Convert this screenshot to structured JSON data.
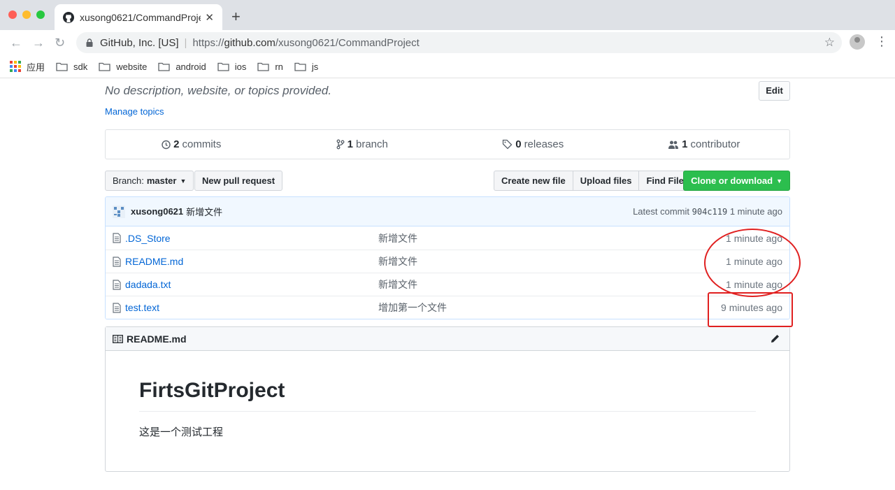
{
  "browser": {
    "tab_title": "xusong0621/CommandProject",
    "tab_close": "✕",
    "new_tab": "+",
    "site_identity": "GitHub, Inc. [US]",
    "url_prefix": "https://",
    "url_host": "github.com",
    "url_path": "/xusong0621/CommandProject",
    "bookmarks": [
      {
        "label": "应用"
      },
      {
        "label": "sdk"
      },
      {
        "label": "website"
      },
      {
        "label": "android"
      },
      {
        "label": "ios"
      },
      {
        "label": "rn"
      },
      {
        "label": "js"
      }
    ]
  },
  "repo": {
    "description": "No description, website, or topics provided.",
    "manage_topics": "Manage topics",
    "edit_label": "Edit",
    "numbers": [
      {
        "icon": "history-icon",
        "count": "2",
        "label": "commits"
      },
      {
        "icon": "branch-icon",
        "count": "1",
        "label": "branch"
      },
      {
        "icon": "tag-icon",
        "count": "0",
        "label": "releases"
      },
      {
        "icon": "people-icon",
        "count": "1",
        "label": "contributor"
      }
    ]
  },
  "file_nav": {
    "branch_prefix": "Branch:",
    "branch_name": "master",
    "new_pull_request": "New pull request",
    "create_new_file": "Create new file",
    "upload_files": "Upload files",
    "find_file": "Find File",
    "clone": "Clone or download"
  },
  "commit": {
    "author": "xusong0621",
    "message": "新增文件",
    "latest_label": "Latest commit",
    "sha": "904c119",
    "age": "1 minute ago"
  },
  "files": [
    {
      "name": ".DS_Store",
      "message": "新增文件",
      "age": "1 minute ago"
    },
    {
      "name": "README.md",
      "message": "新增文件",
      "age": "1 minute ago"
    },
    {
      "name": "dadada.txt",
      "message": "新增文件",
      "age": "1 minute ago"
    },
    {
      "name": "test.text",
      "message": "增加第一个文件",
      "age": "9 minutes ago"
    }
  ],
  "readme": {
    "filename": "README.md",
    "heading": "FirtsGitProject",
    "body": "这是一个测试工程"
  },
  "colors": {
    "link": "#0366d6",
    "clone_green": "#2cbe4e",
    "annotation_red": "#e02020"
  }
}
